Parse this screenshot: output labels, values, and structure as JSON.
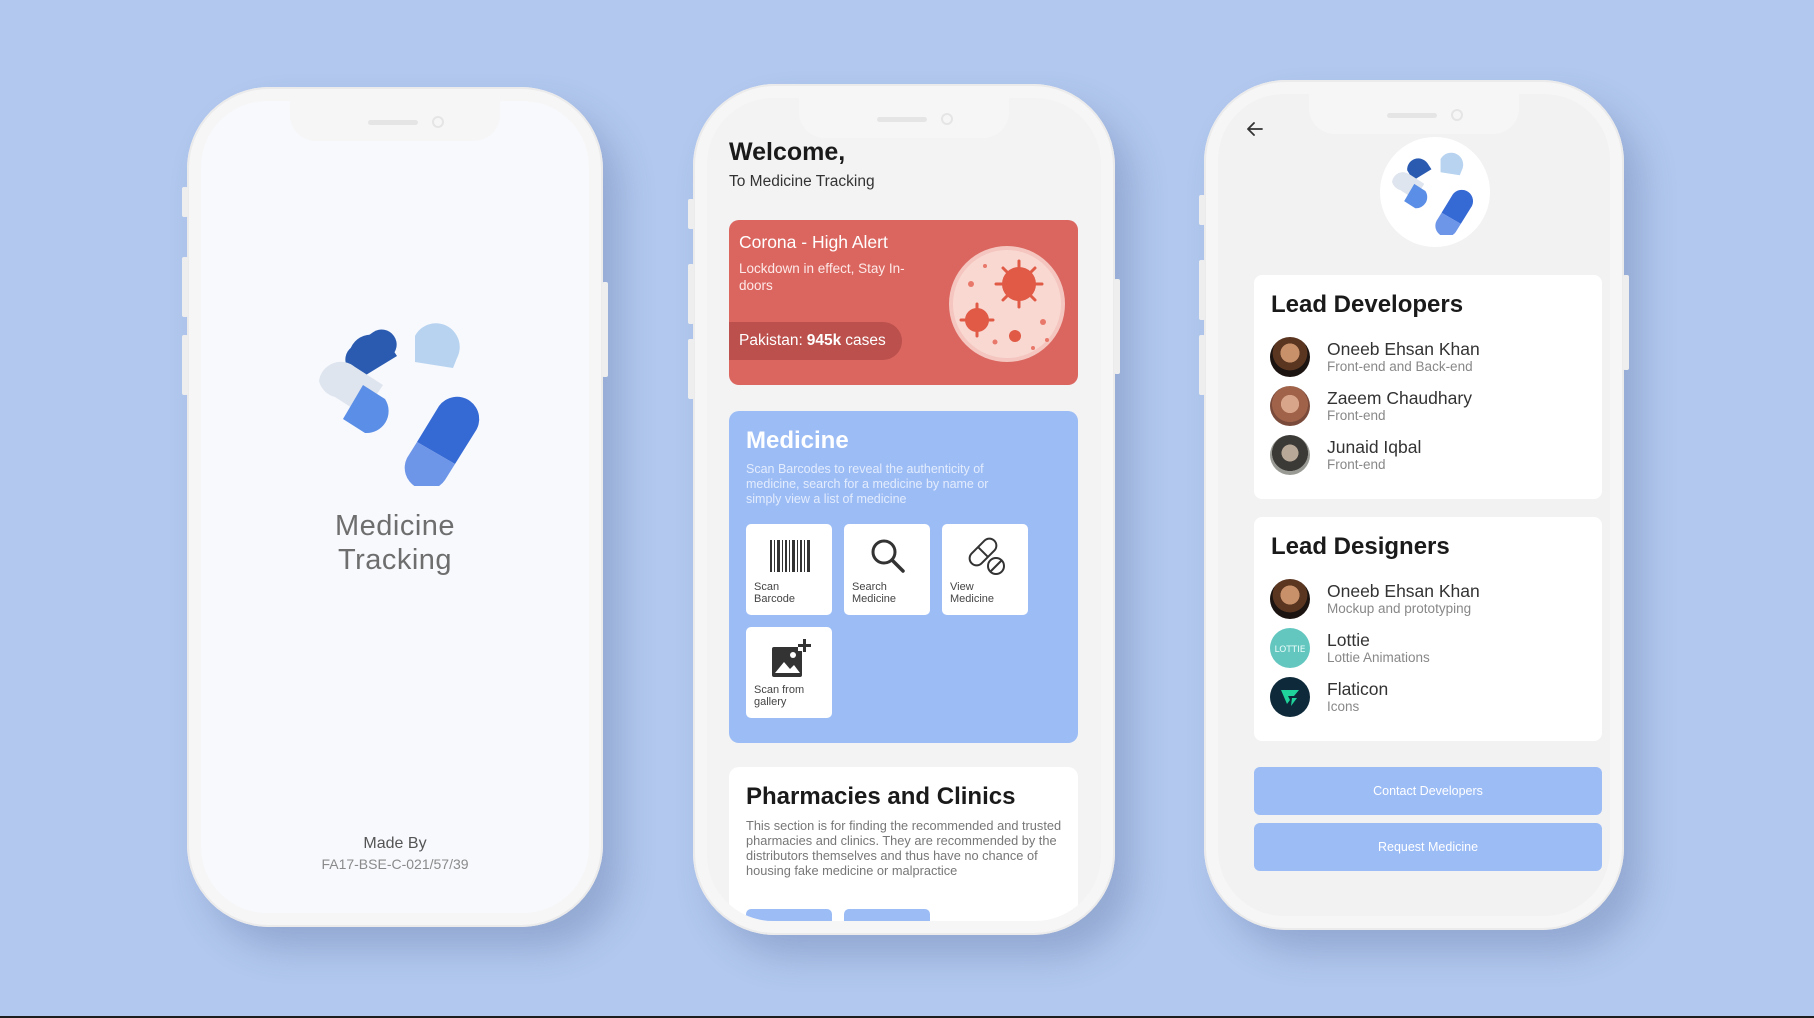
{
  "colors": {
    "background": "#b2c8ee",
    "accent": "#9cbcf5",
    "alert": "#db6660",
    "logo_dark_blue": "#2b5bb0",
    "logo_light_blue": "#b7d3f0"
  },
  "splash": {
    "app_title": "Medicine\nTracking",
    "made_by_label": "Made By",
    "made_by_id": "FA17-BSE-C-021/57/39"
  },
  "home": {
    "welcome": "Welcome,",
    "welcome_sub": "To Medicine Tracking",
    "alert": {
      "title": "Corona - High Alert",
      "description": "Lockdown in effect, Stay In-doors",
      "cases_prefix": "Pakistan:",
      "cases_value": "945k",
      "cases_suffix": "cases"
    },
    "medicine": {
      "title": "Medicine",
      "description": "Scan Barcodes to reveal the authenticity of medicine, search for a medicine by name or simply view a list of medicine",
      "tiles": [
        {
          "label": "Scan\nBarcode",
          "icon": "barcode-icon"
        },
        {
          "label": "Search\nMedicine",
          "icon": "search-icon"
        },
        {
          "label": "View\nMedicine",
          "icon": "pills-icon"
        },
        {
          "label": "Scan from\ngallery",
          "icon": "add-image-icon"
        }
      ]
    },
    "pharmacies": {
      "title": "Pharmacies and Clinics",
      "description": "This section is for finding the recommended and trusted pharmacies and clinics. They are recommended by the distributors themselves and thus have no chance of housing fake medicine or malpractice"
    }
  },
  "about": {
    "developers": {
      "title": "Lead Developers",
      "members": [
        {
          "name": "Oneeb Ehsan Khan",
          "role": "Front-end and Back-end"
        },
        {
          "name": "Zaeem Chaudhary",
          "role": "Front-end"
        },
        {
          "name": "Junaid Iqbal",
          "role": "Front-end"
        }
      ]
    },
    "designers": {
      "title": "Lead Designers",
      "members": [
        {
          "name": "Oneeb Ehsan Khan",
          "role": "Mockup and prototyping"
        },
        {
          "name": "Lottie",
          "role": "Lottie Animations",
          "logo_text": "LOTTIE"
        },
        {
          "name": "Flaticon",
          "role": "Icons"
        }
      ]
    },
    "contact_button": "Contact Developers",
    "request_button": "Request Medicine"
  }
}
